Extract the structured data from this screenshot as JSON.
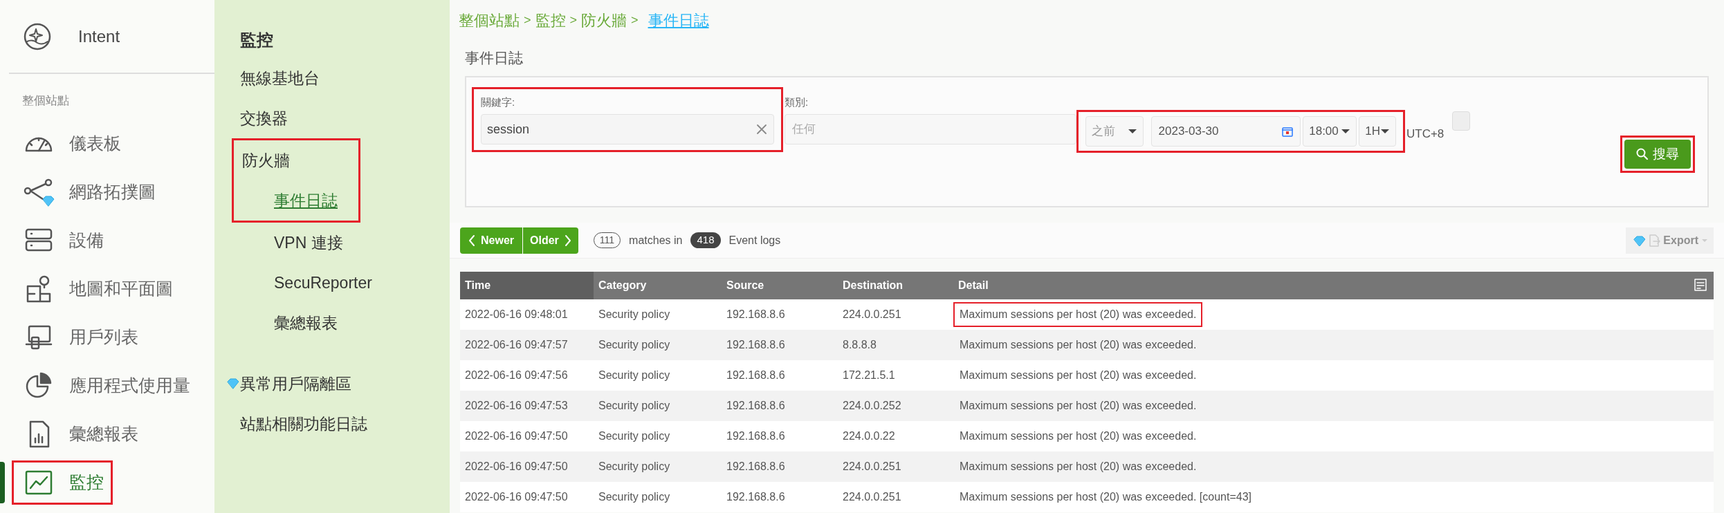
{
  "sidebar": {
    "title": "Intent",
    "section_label": "整個站點",
    "items": [
      {
        "label": "儀表板",
        "selected": false,
        "highlighted": false,
        "premium": false
      },
      {
        "label": "網路拓撲圖",
        "selected": false,
        "highlighted": false,
        "premium": true
      },
      {
        "label": "設備",
        "selected": false,
        "highlighted": false,
        "premium": false
      },
      {
        "label": "地圖和平面圖",
        "selected": false,
        "highlighted": false,
        "premium": false
      },
      {
        "label": "用戶列表",
        "selected": false,
        "highlighted": false,
        "premium": false
      },
      {
        "label": "應用程式使用量",
        "selected": false,
        "highlighted": false,
        "premium": false
      },
      {
        "label": "彙總報表",
        "selected": false,
        "highlighted": false,
        "premium": false
      },
      {
        "label": "監控",
        "selected": true,
        "highlighted": true,
        "premium": false
      }
    ]
  },
  "submenu": {
    "title": "監控",
    "items": [
      {
        "label": "無線基地台",
        "highlighted": false
      },
      {
        "label": "交換器",
        "highlighted": false
      },
      {
        "label": "防火牆",
        "highlighted": true,
        "children": [
          {
            "label": "事件日誌",
            "selected": true,
            "highlighted": true
          },
          {
            "label": "VPN 連接",
            "selected": false,
            "highlighted": false
          },
          {
            "label": "SecuReporter",
            "selected": false,
            "highlighted": false
          },
          {
            "label": "彙總報表",
            "selected": false,
            "highlighted": false
          }
        ]
      },
      {
        "label": "異常用戶隔離區",
        "highlighted": false,
        "premium": true
      },
      {
        "label": "站點相關功能日誌",
        "highlighted": false
      }
    ]
  },
  "breadcrumb": {
    "separator": ">",
    "items": [
      {
        "label": "整個站點",
        "current": false
      },
      {
        "label": "監控",
        "current": false
      },
      {
        "label": "防火牆",
        "current": false
      },
      {
        "label": "事件日誌",
        "current": true
      }
    ]
  },
  "page_title": "事件日誌",
  "filters": {
    "keyword": {
      "label": "關鍵字:",
      "value": "session",
      "highlighted": true
    },
    "category": {
      "label": "類別:",
      "placeholder": "任何"
    },
    "time_range": {
      "highlighted": true,
      "relation": "之前",
      "date": "2023-03-30",
      "time": "18:00",
      "span": "1H"
    },
    "timezone": "UTC+8",
    "search_button": {
      "label": "搜尋",
      "highlighted": true
    }
  },
  "toolbar": {
    "newer": "Newer",
    "older": "Older",
    "matches": "111",
    "matches_text": "matches in",
    "total": "418",
    "total_text": "Event logs",
    "export": {
      "label": "Export",
      "disabled": true,
      "premium": true
    }
  },
  "table": {
    "columns": [
      "Time",
      "Category",
      "Source",
      "Destination",
      "Detail"
    ],
    "rows": [
      {
        "cells": [
          "2022-06-16 09:48:01",
          "Security policy",
          "192.168.8.6",
          "224.0.0.251",
          "Maximum sessions per host (20) was exceeded."
        ],
        "highlighted": true
      },
      {
        "cells": [
          "2022-06-16 09:47:57",
          "Security policy",
          "192.168.8.6",
          "8.8.8.8",
          "Maximum sessions per host (20) was exceeded."
        ],
        "highlighted": false
      },
      {
        "cells": [
          "2022-06-16 09:47:56",
          "Security policy",
          "192.168.8.6",
          "172.21.5.1",
          "Maximum sessions per host (20) was exceeded."
        ],
        "highlighted": false
      },
      {
        "cells": [
          "2022-06-16 09:47:53",
          "Security policy",
          "192.168.8.6",
          "224.0.0.252",
          "Maximum sessions per host (20) was exceeded."
        ],
        "highlighted": false
      },
      {
        "cells": [
          "2022-06-16 09:47:50",
          "Security policy",
          "192.168.8.6",
          "224.0.0.22",
          "Maximum sessions per host (20) was exceeded."
        ],
        "highlighted": false
      },
      {
        "cells": [
          "2022-06-16 09:47:50",
          "Security policy",
          "192.168.8.6",
          "224.0.0.251",
          "Maximum sessions per host (20) was exceeded."
        ],
        "highlighted": false
      },
      {
        "cells": [
          "2022-06-16 09:47:50",
          "Security policy",
          "192.168.8.6",
          "224.0.0.251",
          "Maximum sessions per host (20) was exceeded. [count=43]"
        ],
        "highlighted": false
      }
    ]
  }
}
